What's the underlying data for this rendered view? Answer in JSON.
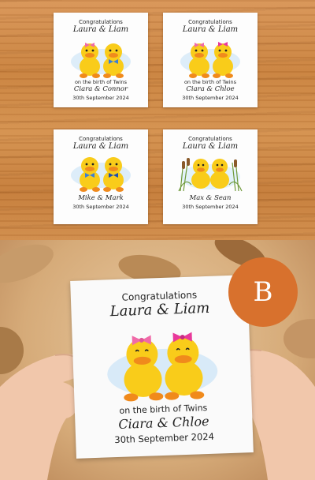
{
  "cards": [
    {
      "congrats": "Congratulations",
      "names": "Laura & Liam",
      "birth_line": "on the birth of Twins",
      "babies": "Ciara & Connor",
      "date": "30th September 2024",
      "bows": [
        "pink",
        "blue-bowtie"
      ]
    },
    {
      "congrats": "Congratulations",
      "names": "Laura & Liam",
      "birth_line": "on the birth of Twins",
      "babies": "Ciara & Chloe",
      "date": "30th September 2024",
      "bows": [
        "pink",
        "pink"
      ]
    },
    {
      "congrats": "Congratulations",
      "names": "Laura & Liam",
      "babies": "Mike & Mark",
      "date": "30th September 2024",
      "bows": [
        "blue-bowtie",
        "blue-bowtie"
      ]
    },
    {
      "congrats": "Congratulations",
      "names": "Laura & Liam",
      "babies": "Max & Sean",
      "date": "30th September 2024",
      "bows": [
        "none",
        "none"
      ]
    }
  ],
  "featured_card": {
    "congrats": "Congratulations",
    "names": "Laura & Liam",
    "birth_line": "on the birth of Twins",
    "babies": "Ciara & Chloe",
    "date": "30th September 2024"
  },
  "badge": {
    "label": "B",
    "color": "#d8712d"
  },
  "colors": {
    "duck_yellow": "#f9cc1a",
    "duck_orange": "#f08a1c",
    "bow_pink": "#f06aa8",
    "bow_blue": "#3c7fd6"
  }
}
